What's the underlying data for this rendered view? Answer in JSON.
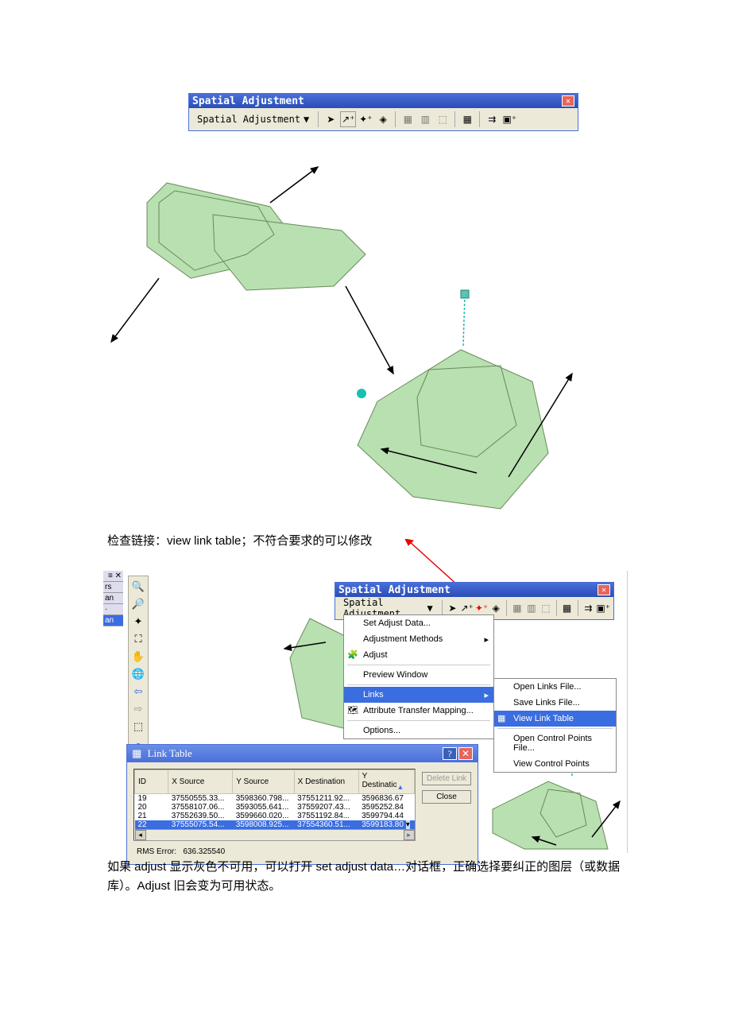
{
  "toolbar1": {
    "title": "Spatial Adjustment",
    "menu_label": "Spatial Adjustment",
    "icons": [
      "select",
      "new-link",
      "modify-link",
      "move",
      "grid1",
      "grid2",
      "grid3",
      "table",
      "adjust",
      "attribute"
    ]
  },
  "para1": "检查链接：view link table；不符合要求的可以修改",
  "toolbar2": {
    "title": "Spatial Adjustment",
    "menu_label": "Spatial Adjustment"
  },
  "menu": {
    "items": [
      {
        "label": "Set Adjust Data...",
        "icon": ""
      },
      {
        "label": "Adjustment Methods",
        "submenu": true
      },
      {
        "label": "Adjust",
        "icon": "🔧"
      },
      {
        "label": "Preview Window",
        "divider_after": true
      },
      {
        "label": "Links",
        "submenu": true,
        "selected": true
      },
      {
        "label": "Attribute Transfer Mapping...",
        "icon": "🗺"
      },
      {
        "label": "Options..."
      }
    ]
  },
  "submenu": {
    "items": [
      {
        "label": "Open Links File..."
      },
      {
        "label": "Save Links File..."
      },
      {
        "label": "View Link Table",
        "selected": true,
        "icon": "📊"
      },
      {
        "label": "Open Control Points File..."
      },
      {
        "label": "View Control Points"
      }
    ]
  },
  "shot2_side_tabs": [
    "✕",
    "rs",
    "an",
    "·",
    "an"
  ],
  "link_table": {
    "title": "Link Table",
    "cols": [
      "ID",
      "X Source",
      "Y Source",
      "X Destination",
      "Y Destination"
    ],
    "rows": [
      {
        "id": "19",
        "xs": "37550555.33...",
        "ys": "3598360.798...",
        "xd": "37551211.92...",
        "yd": "3596836.67"
      },
      {
        "id": "20",
        "xs": "37558107.06...",
        "ys": "3593055.641...",
        "xd": "37559207.43...",
        "yd": "3595252.84"
      },
      {
        "id": "21",
        "xs": "37552639.50...",
        "ys": "3599660.020...",
        "xd": "37551192.84...",
        "yd": "3599794.44"
      },
      {
        "id": "22",
        "xs": "37555075.54...",
        "ys": "3598008.925...",
        "xd": "37554360.51...",
        "yd": "3599183.80",
        "selected": true
      }
    ],
    "delete_btn": "Delete Link",
    "close_btn": "Close",
    "rms_label": "RMS Error:",
    "rms_value": "636.325540"
  },
  "para2": "如果 adjust 显示灰色不可用，可以打开 set adjust data…对话框，正确选择要纠正的图层（或数据库）。Adjust 旧会变为可用状态。"
}
